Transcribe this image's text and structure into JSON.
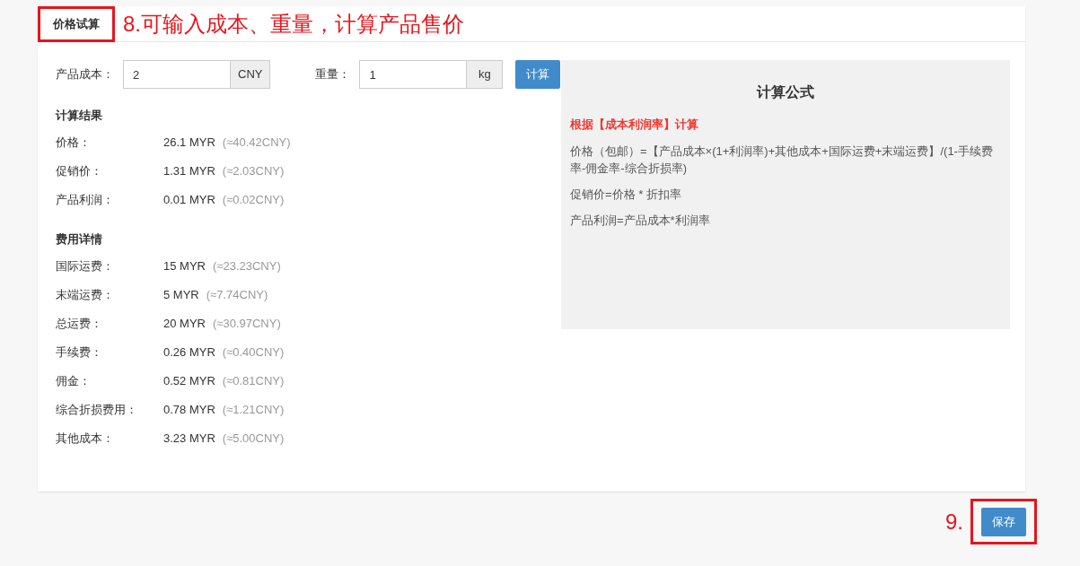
{
  "tab": {
    "label": "价格试算",
    "selected": true
  },
  "annotations": [
    {
      "text": "8.可输入成本、重量，计算产品售价"
    },
    {
      "text": "9."
    }
  ],
  "inputs": [
    {
      "label": "产品成本：",
      "value": "2",
      "unit": "CNY"
    },
    {
      "label": "重量：",
      "value": "1",
      "unit": "kg"
    }
  ],
  "calculate_button": "计算",
  "sections": [
    {
      "title": "计算结果",
      "rows": [
        {
          "label": "价格：",
          "value": "26.1 MYR",
          "converted": "(≈40.42CNY)"
        },
        {
          "label": "促销价：",
          "value": "1.31 MYR",
          "converted": "(≈2.03CNY)"
        },
        {
          "label": "产品利润：",
          "value": "0.01 MYR",
          "converted": "(≈0.02CNY)"
        }
      ]
    },
    {
      "title": "费用详情",
      "rows": [
        {
          "label": "国际运费：",
          "value": "15 MYR",
          "converted": "(≈23.23CNY)"
        },
        {
          "label": "末端运费：",
          "value": "5 MYR",
          "converted": "(≈7.74CNY)"
        },
        {
          "label": "总运费：",
          "value": "20 MYR",
          "converted": "(≈30.97CNY)"
        },
        {
          "label": "手续费：",
          "value": "0.26 MYR",
          "converted": "(≈0.40CNY)"
        },
        {
          "label": "佣金：",
          "value": "0.52 MYR",
          "converted": "(≈0.81CNY)"
        },
        {
          "label": "综合折损费用：",
          "value": "0.78 MYR",
          "converted": "(≈1.21CNY)"
        },
        {
          "label": "其他成本：",
          "value": "3.23 MYR",
          "converted": "(≈5.00CNY)"
        }
      ]
    }
  ],
  "formula": {
    "title": "计算公式",
    "basis": "根据【成本利润率】计算",
    "lines": [
      "价格（包邮）=【产品成本×(1+利润率)+其他成本+国际运费+末端运费】/(1-手续费率-佣金率-综合折损率)",
      "促销价=价格 * 折扣率",
      "产品利润=产品成本*利润率"
    ]
  },
  "save_button": "保存"
}
